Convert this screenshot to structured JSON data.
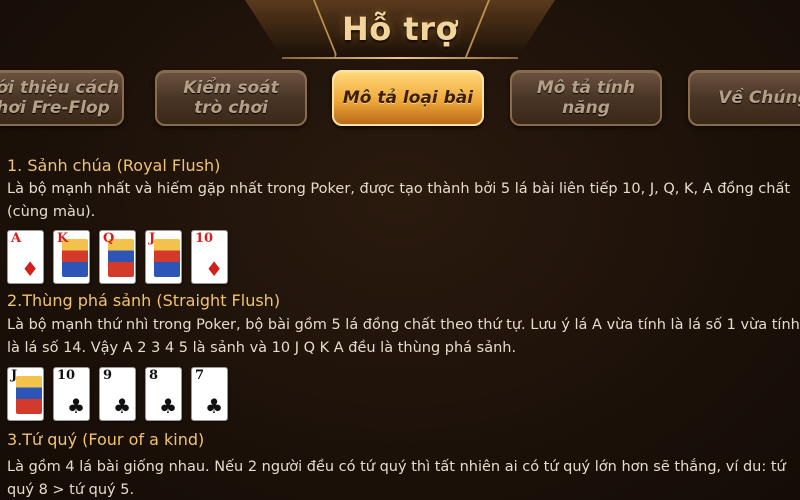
{
  "header": {
    "title": "Hỗ trợ"
  },
  "tabs": [
    {
      "label": "Giới thiệu cách\nchơi Fre-Flop",
      "active": false
    },
    {
      "label": "Kiểm soát\ntrò chơi",
      "active": false
    },
    {
      "label": "Mô tả loại bài",
      "active": true
    },
    {
      "label": "Mô tả tính năng",
      "active": false
    },
    {
      "label": "Về Chúng",
      "active": false
    }
  ],
  "sections": [
    {
      "title": "1. Sảnh chúa (Royal Flush)",
      "body_line1": "Là bộ mạnh nhất và hiếm gặp nhất trong Poker, được tạo thành bởi 5 lá bài liên tiếp 10, J, Q, K, A đồng  chất",
      "body_line2": " (cùng màu).",
      "cards": [
        {
          "rank": "A",
          "suit": "♦",
          "color": "red",
          "face": false
        },
        {
          "rank": "K",
          "suit": "♦",
          "color": "red",
          "face": true
        },
        {
          "rank": "Q",
          "suit": "♦",
          "color": "red",
          "face": true
        },
        {
          "rank": "J",
          "suit": "♦",
          "color": "red",
          "face": true
        },
        {
          "rank": "10",
          "suit": "♦",
          "color": "red",
          "face": false
        }
      ]
    },
    {
      "title": "2.Thùng phá sảnh (Straight Flush)",
      "body_line1": "Là bộ mạnh thứ nhì trong Poker, bộ bài gồm 5 lá đồng chất theo thứ tự. Lưu ý lá A vừa tính là lá số 1 vừa tính",
      "body_line2": "là lá số 14. Vậy A 2 3 4 5 là sảnh và 10 J Q K A đều là thùng phá sảnh.",
      "cards": [
        {
          "rank": "J",
          "suit": "♣",
          "color": "black",
          "face": true
        },
        {
          "rank": "10",
          "suit": "♣",
          "color": "black",
          "face": false
        },
        {
          "rank": "9",
          "suit": "♣",
          "color": "black",
          "face": false
        },
        {
          "rank": "8",
          "suit": "♣",
          "color": "black",
          "face": false
        },
        {
          "rank": "7",
          "suit": "♣",
          "color": "black",
          "face": false
        }
      ]
    },
    {
      "title": "3.Tứ quý (Four of a kind)",
      "body_line1": "Là gồm 4 lá bài giống nhau. Nếu 2 người đều có tứ quý thì tất nhiên ai có tứ quý lớn hơn sẽ thắng, ví du: tứ",
      "body_line2": "quý 8 > tứ quý 5."
    }
  ],
  "colors": {
    "accent_gold": "#f1c46c",
    "title_gold": "#f3d49a",
    "active_tab": "#f0a83a",
    "background": "#1c1109"
  }
}
